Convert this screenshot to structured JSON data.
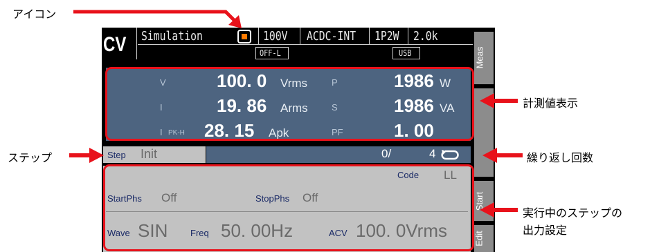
{
  "header": {
    "mode": "CV",
    "function": "Simulation",
    "voltage_range": "100V",
    "output_mode": "ACDC-INT",
    "wiring": "1P2W",
    "freq_range": "2.0k",
    "sub_status": "OFF-L",
    "interface": "USB"
  },
  "measurements": {
    "rows": [
      {
        "label": "V",
        "value": "100. 0",
        "unit": "Vrms",
        "label2": "P",
        "value2": "1986",
        "unit2": "W"
      },
      {
        "label": "I",
        "value": "19. 86",
        "unit": "Arms",
        "label2": "S",
        "value2": "1986",
        "unit2": "VA"
      },
      {
        "label": "I",
        "label_sub": "PK-H",
        "value": "28. 15",
        "unit": "Apk",
        "label2": "PF",
        "value2": "1. 00",
        "unit2": ""
      }
    ]
  },
  "step": {
    "label": "Step",
    "name": "Init",
    "current": "0/",
    "total": "4"
  },
  "output_settings": {
    "code_label": "Code",
    "code_value": "LL",
    "start_phs_label": "StartPhs",
    "start_phs_value": "Off",
    "stop_phs_label": "StopPhs",
    "stop_phs_value": "Off",
    "wave_label": "Wave",
    "wave_value": "SIN",
    "freq_label": "Freq",
    "freq_value": "50. 00Hz",
    "acv_label": "ACV",
    "acv_value": "100. 0Vrms"
  },
  "softkeys": [
    "Meas",
    "Start",
    "Edit"
  ],
  "callouts": {
    "icon": "アイコン",
    "measurement_display": "計測値表示",
    "step": "ステップ",
    "repeat_count": "繰り返し回数",
    "running_step_output_line1": "実行中のステップの",
    "running_step_output_line2": "出力設定"
  },
  "colors": {
    "accent_red": "#e8121b",
    "measurement_panel": "#4d6480",
    "icon_orange": "#ff7a00"
  }
}
